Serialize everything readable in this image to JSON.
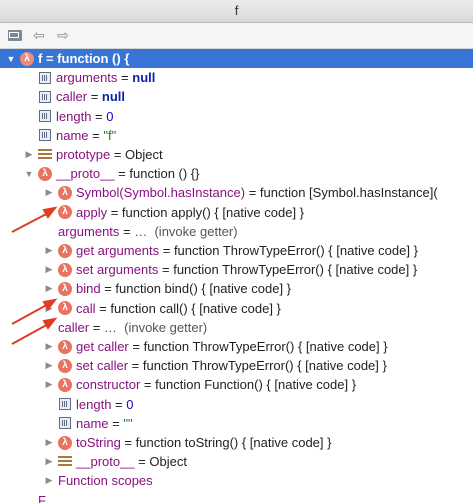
{
  "window": {
    "title": "f"
  },
  "rows": [
    {
      "indent": 0,
      "tri": "▼",
      "icon": "fn",
      "name": "f",
      "eq": " = ",
      "value": "function () {",
      "vclass": "val",
      "selected": true
    },
    {
      "indent": 1,
      "tri": "",
      "icon": "field",
      "name": "arguments",
      "eq": " = ",
      "value": "null",
      "vclass": "kw"
    },
    {
      "indent": 1,
      "tri": "",
      "icon": "field",
      "name": "caller",
      "eq": " = ",
      "value": "null",
      "vclass": "kw"
    },
    {
      "indent": 1,
      "tri": "",
      "icon": "field",
      "name": "length",
      "eq": " = ",
      "value": "0",
      "vclass": "num"
    },
    {
      "indent": 1,
      "tri": "",
      "icon": "field",
      "name": "name",
      "eq": " = ",
      "value": "\"f\"",
      "vclass": "str"
    },
    {
      "indent": 1,
      "tri": "▶",
      "icon": "proto",
      "name": "prototype",
      "eq": " = ",
      "value": "Object",
      "vclass": "val"
    },
    {
      "indent": 1,
      "tri": "▼",
      "icon": "fn",
      "name": "__proto__",
      "eq": " = ",
      "value": "function () {}",
      "vclass": "val"
    },
    {
      "indent": 2,
      "tri": "▶",
      "icon": "fn",
      "name": "Symbol(Symbol.hasInstance)",
      "eq": " = ",
      "value": "function [Symbol.hasInstance](",
      "vclass": "val"
    },
    {
      "indent": 2,
      "tri": "▶",
      "icon": "fn",
      "name": "apply",
      "eq": " = ",
      "value": "function apply() { [native code] }",
      "vclass": "val"
    },
    {
      "indent": 2,
      "tri": "",
      "icon": "none",
      "name": "arguments",
      "eq": " = ",
      "value": "…  (invoke getter)",
      "vclass": "gray"
    },
    {
      "indent": 2,
      "tri": "▶",
      "icon": "fn",
      "name": "get arguments",
      "eq": " = ",
      "value": "function ThrowTypeError() { [native code] }",
      "vclass": "val"
    },
    {
      "indent": 2,
      "tri": "▶",
      "icon": "fn",
      "name": "set arguments",
      "eq": " = ",
      "value": "function ThrowTypeError() { [native code] }",
      "vclass": "val"
    },
    {
      "indent": 2,
      "tri": "▶",
      "icon": "fn",
      "name": "bind",
      "eq": " = ",
      "value": "function bind() { [native code] }",
      "vclass": "val"
    },
    {
      "indent": 2,
      "tri": "▶",
      "icon": "fn",
      "name": "call",
      "eq": " = ",
      "value": "function call() { [native code] }",
      "vclass": "val"
    },
    {
      "indent": 2,
      "tri": "",
      "icon": "none",
      "name": "caller",
      "eq": " = ",
      "value": "…  (invoke getter)",
      "vclass": "gray"
    },
    {
      "indent": 2,
      "tri": "▶",
      "icon": "fn",
      "name": "get caller",
      "eq": " = ",
      "value": "function ThrowTypeError() { [native code] }",
      "vclass": "val"
    },
    {
      "indent": 2,
      "tri": "▶",
      "icon": "fn",
      "name": "set caller",
      "eq": " = ",
      "value": "function ThrowTypeError() { [native code] }",
      "vclass": "val"
    },
    {
      "indent": 2,
      "tri": "▶",
      "icon": "fn",
      "name": "constructor",
      "eq": " = ",
      "value": "function Function() { [native code] }",
      "vclass": "val"
    },
    {
      "indent": 2,
      "tri": "",
      "icon": "field",
      "name": "length",
      "eq": " = ",
      "value": "0",
      "vclass": "num"
    },
    {
      "indent": 2,
      "tri": "",
      "icon": "field",
      "name": "name",
      "eq": " = ",
      "value": "\"\"",
      "vclass": "str"
    },
    {
      "indent": 2,
      "tri": "▶",
      "icon": "fn",
      "name": "toString",
      "eq": " = ",
      "value": "function toString() { [native code] }",
      "vclass": "val"
    },
    {
      "indent": 2,
      "tri": "▶",
      "icon": "proto",
      "name": "__proto__",
      "eq": " = ",
      "value": "Object",
      "vclass": "val"
    },
    {
      "indent": 2,
      "tri": "▶",
      "icon": "none",
      "name": "Function scopes",
      "eq": "",
      "value": "",
      "vclass": "val"
    },
    {
      "indent": 1,
      "tri": "",
      "icon": "none",
      "name": "F…",
      "eq": "",
      "value": "",
      "vclass": "val"
    }
  ],
  "icons": {
    "function": "lambda-icon",
    "field": "field-icon",
    "prototype": "prototype-icon"
  },
  "colors": {
    "selection": "#3875d7",
    "function_icon": "#e8735f",
    "annotation_arrow": "#e03b24"
  }
}
